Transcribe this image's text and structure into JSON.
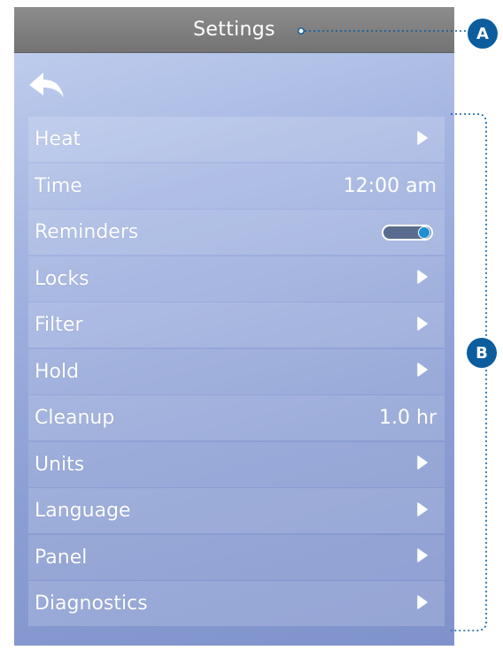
{
  "header": {
    "title": "Settings"
  },
  "back": {
    "icon": "back-arrow-icon"
  },
  "menu": {
    "items": [
      {
        "label": "Heat",
        "control": "arrow"
      },
      {
        "label": "Time",
        "control": "value",
        "value": "12:00 am"
      },
      {
        "label": "Reminders",
        "control": "toggle",
        "state": "on"
      },
      {
        "label": "Locks",
        "control": "arrow"
      },
      {
        "label": "Filter",
        "control": "arrow"
      },
      {
        "label": "Hold",
        "control": "arrow"
      },
      {
        "label": "Cleanup",
        "control": "value",
        "value": "1.0 hr"
      },
      {
        "label": "Units",
        "control": "arrow"
      },
      {
        "label": "Language",
        "control": "arrow"
      },
      {
        "label": "Panel",
        "control": "arrow"
      },
      {
        "label": "Diagnostics",
        "control": "arrow"
      }
    ]
  },
  "callouts": {
    "a": "A",
    "b": "B"
  },
  "colors": {
    "titlebar": "#7f7f7f",
    "screen_top": "#c4d2ef",
    "screen_bottom": "#7f92cb",
    "callout_badge": "#0b5d9e",
    "toggle_knob": "#1e8fd3"
  }
}
